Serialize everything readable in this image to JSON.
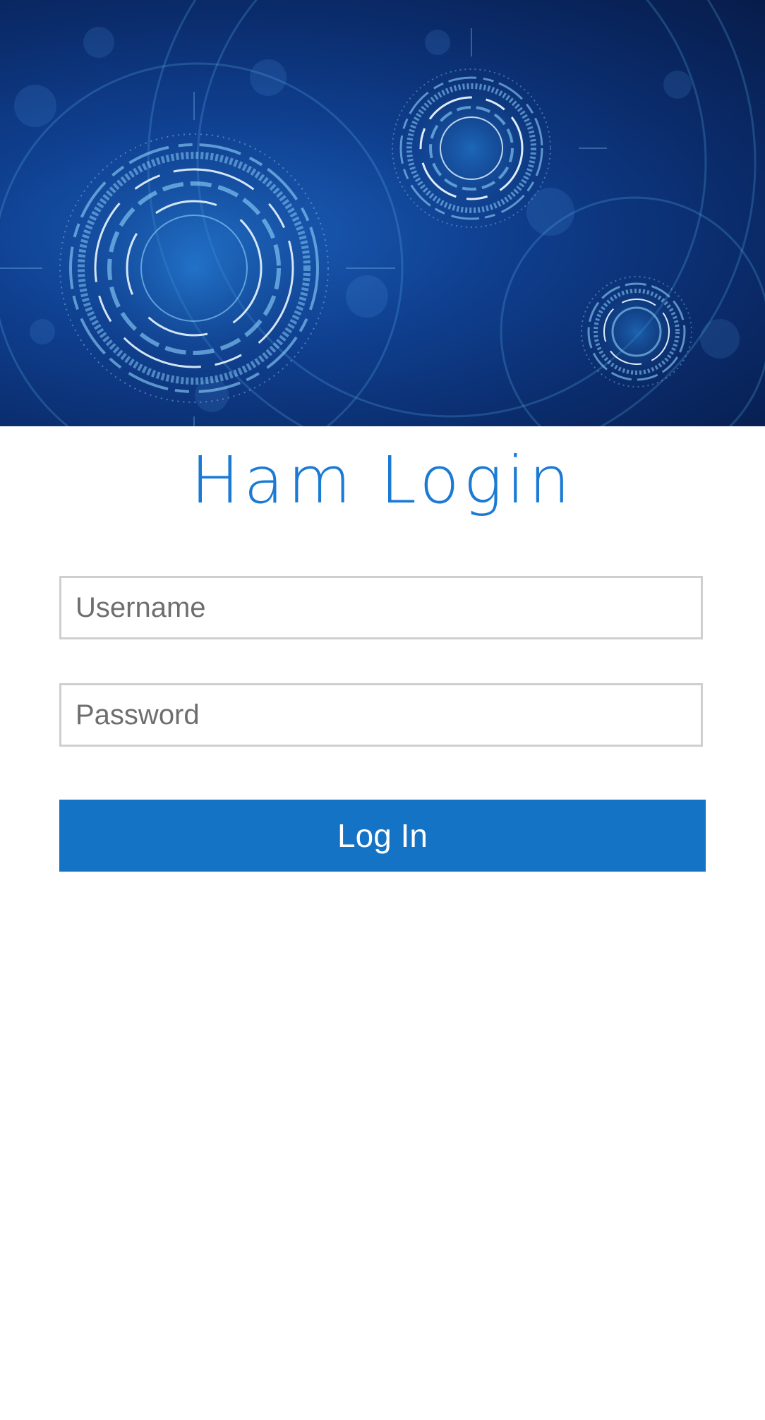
{
  "login": {
    "title": "Ham Login",
    "username_placeholder": "Username",
    "password_placeholder": "Password",
    "submit_label": "Log In"
  },
  "colors": {
    "accent": "#1573c6",
    "title": "#1a7ad4",
    "field_border": "#cfcfcf",
    "placeholder": "#6e6e6e"
  },
  "hero": {
    "image": "blue-tech-circles-banner"
  }
}
